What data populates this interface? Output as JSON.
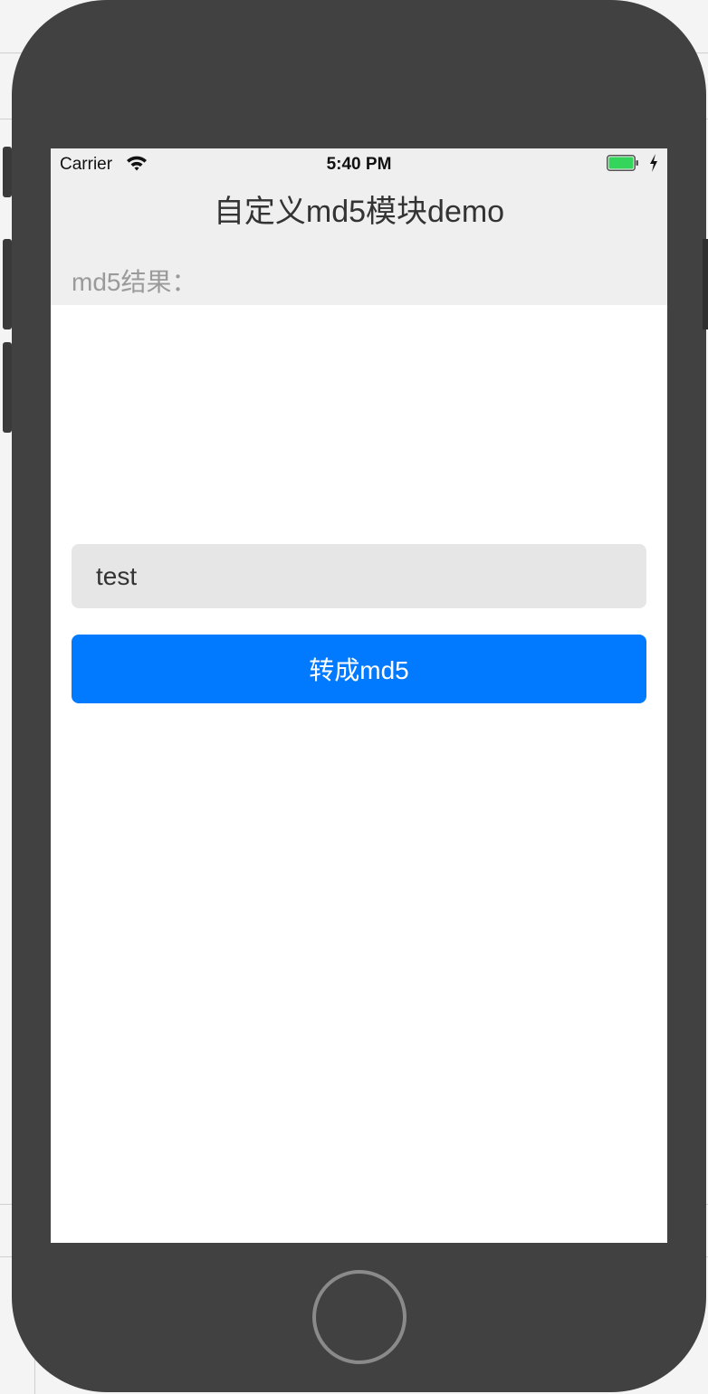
{
  "statusbar": {
    "carrier": "Carrier",
    "time": "5:40 PM",
    "battery_color": "#33d65a"
  },
  "navbar": {
    "title": "自定义md5模块demo"
  },
  "result": {
    "label": "md5结果："
  },
  "input": {
    "value": "test"
  },
  "convert_button": {
    "label": "转成md5",
    "color": "#017aff"
  },
  "icons": {
    "wifi": "wifi-icon",
    "battery": "battery-icon",
    "charging": "charging-bolt-icon",
    "home": "home-button"
  }
}
